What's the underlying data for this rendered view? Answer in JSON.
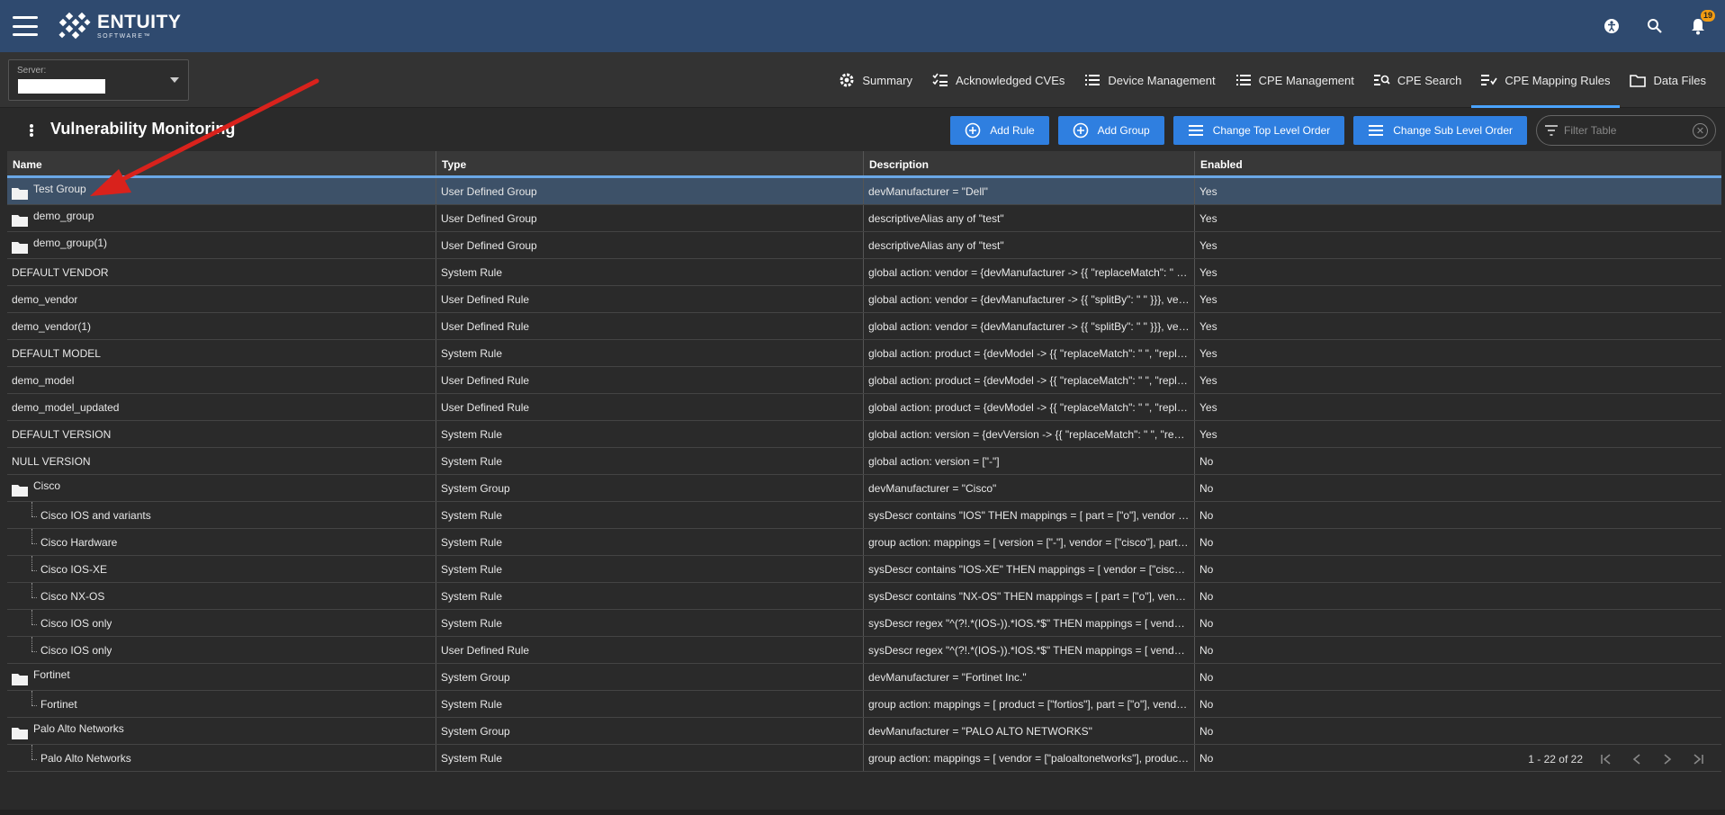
{
  "app": {
    "brand": "ENTUITY",
    "brand_sub": "SOFTWARE™",
    "notification_count": "19"
  },
  "server": {
    "label": "Server:",
    "value": ""
  },
  "nav": [
    {
      "label": "Summary",
      "icon": "gear-icon"
    },
    {
      "label": "Acknowledged CVEs",
      "icon": "checklist-icon"
    },
    {
      "label": "Device Management",
      "icon": "list-icon"
    },
    {
      "label": "CPE Management",
      "icon": "list-icon"
    },
    {
      "label": "CPE Search",
      "icon": "search-list-icon"
    },
    {
      "label": "CPE Mapping Rules",
      "icon": "mapping-icon",
      "active": true
    },
    {
      "label": "Data Files",
      "icon": "folder-icon"
    }
  ],
  "toolbar": {
    "title": "Vulnerability Monitoring",
    "add_rule": "Add Rule",
    "add_group": "Add Group",
    "change_top": "Change Top Level Order",
    "change_sub": "Change Sub Level Order",
    "filter_placeholder": "Filter Table"
  },
  "table": {
    "columns": [
      "Name",
      "Type",
      "Description",
      "Enabled"
    ],
    "rows": [
      {
        "name": "Test Group",
        "kind": "group",
        "type": "User Defined Group",
        "description": "devManufacturer = \"Dell\"",
        "enabled": "Yes",
        "selected": true
      },
      {
        "name": "demo_group",
        "kind": "group",
        "type": "User Defined Group",
        "description": "descriptiveAlias any of \"test\"",
        "enabled": "Yes"
      },
      {
        "name": "demo_group(1)",
        "kind": "group",
        "type": "User Defined Group",
        "description": "descriptiveAlias any of \"test\"",
        "enabled": "Yes"
      },
      {
        "name": "DEFAULT VENDOR",
        "kind": "rule",
        "type": "System Rule",
        "description": "global action: vendor = {devManufacturer -> {{ \"replaceMatch\": \" \", ...",
        "enabled": "Yes"
      },
      {
        "name": "demo_vendor",
        "kind": "rule",
        "type": "User Defined Rule",
        "description": "global action: vendor = {devManufacturer -> {{ \"splitBy\": \" \" }}}, ven...",
        "enabled": "Yes"
      },
      {
        "name": "demo_vendor(1)",
        "kind": "rule",
        "type": "User Defined Rule",
        "description": "global action: vendor = {devManufacturer -> {{ \"splitBy\": \" \" }}}, ven...",
        "enabled": "Yes"
      },
      {
        "name": "DEFAULT MODEL",
        "kind": "rule",
        "type": "System Rule",
        "description": "global action: product = {devModel -> {{ \"replaceMatch\": \" \", \"repla...",
        "enabled": "Yes"
      },
      {
        "name": "demo_model",
        "kind": "rule",
        "type": "User Defined Rule",
        "description": "global action: product = {devModel -> {{ \"replaceMatch\": \" \", \"repla...",
        "enabled": "Yes"
      },
      {
        "name": "demo_model_updated",
        "kind": "rule",
        "type": "User Defined Rule",
        "description": "global action: product = {devModel -> {{ \"replaceMatch\": \" \", \"repla...",
        "enabled": "Yes"
      },
      {
        "name": "DEFAULT VERSION",
        "kind": "rule",
        "type": "System Rule",
        "description": "global action: version = {devVersion -> {{ \"replaceMatch\": \" \", \"repla...",
        "enabled": "Yes"
      },
      {
        "name": "NULL VERSION",
        "kind": "rule",
        "type": "System Rule",
        "description": "global action: version = [\"-\"]",
        "enabled": "No"
      },
      {
        "name": "Cisco",
        "kind": "group",
        "type": "System Group",
        "description": "devManufacturer = \"Cisco\"",
        "enabled": "No"
      },
      {
        "name": "Cisco IOS and variants",
        "kind": "child",
        "type": "System Rule",
        "description": "sysDescr contains \"IOS\" THEN mappings = [ part = [\"o\"], vendor = [...",
        "enabled": "No"
      },
      {
        "name": "Cisco Hardware",
        "kind": "child",
        "type": "System Rule",
        "description": "group action: mappings = [ version = [\"-\"], vendor = [\"cisco\"], part = ...",
        "enabled": "No"
      },
      {
        "name": "Cisco IOS-XE",
        "kind": "child",
        "type": "System Rule",
        "description": "sysDescr contains \"IOS-XE\" THEN mappings = [ vendor = [\"cisco\"], ...",
        "enabled": "No"
      },
      {
        "name": "Cisco NX-OS",
        "kind": "child",
        "type": "System Rule",
        "description": "sysDescr contains \"NX-OS\" THEN mappings = [ part = [\"o\"], vendor...",
        "enabled": "No"
      },
      {
        "name": "Cisco IOS only",
        "kind": "child",
        "type": "System Rule",
        "description": "sysDescr regex \"^(?!.*(IOS-)).*IOS.*$\" THEN mappings = [ vendor =...",
        "enabled": "No"
      },
      {
        "name": "Cisco IOS only",
        "kind": "child",
        "type": "User Defined Rule",
        "description": "sysDescr regex \"^(?!.*(IOS-)).*IOS.*$\" THEN mappings = [ vendor =...",
        "enabled": "No"
      },
      {
        "name": "Fortinet",
        "kind": "group",
        "type": "System Group",
        "description": "devManufacturer = \"Fortinet Inc.\"",
        "enabled": "No"
      },
      {
        "name": "Fortinet",
        "kind": "child",
        "type": "System Rule",
        "description": "group action: mappings = [ product = [\"fortios\"], part = [\"o\"], vendor...",
        "enabled": "No"
      },
      {
        "name": "Palo Alto Networks",
        "kind": "group",
        "type": "System Group",
        "description": "devManufacturer = \"PALO ALTO NETWORKS\"",
        "enabled": "No"
      },
      {
        "name": "Palo Alto Networks",
        "kind": "child",
        "type": "System Rule",
        "description": "group action: mappings = [ vendor = [\"paloaltonetworks\"], product ...",
        "enabled": "No"
      }
    ]
  },
  "pager": {
    "range": "1 - 22 of 22"
  },
  "colors": {
    "topbar": "#2f4a6f",
    "accent": "#2f7fe0",
    "selected_row": "#3d5168",
    "annotation_arrow": "#d9221c"
  }
}
